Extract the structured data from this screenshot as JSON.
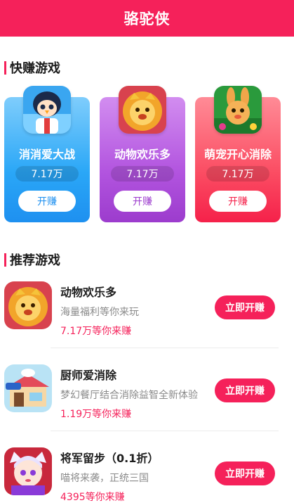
{
  "header": {
    "title": "骆驼侠"
  },
  "sections": {
    "quick": {
      "title": "快赚游戏"
    },
    "recommend": {
      "title": "推荐游戏"
    }
  },
  "featured": [
    {
      "name": "消消爱大战",
      "count": "7.17万",
      "button": "开赚",
      "icon": "penguin-character-icon",
      "color": "#2aa7f7"
    },
    {
      "name": "动物欢乐多",
      "count": "7.17万",
      "button": "开赚",
      "icon": "golden-lion-icon",
      "color": "#b254df"
    },
    {
      "name": "萌宠开心消除",
      "count": "7.17万",
      "button": "开赚",
      "icon": "rabbit-character-icon",
      "color": "#fb4d63"
    }
  ],
  "games": [
    {
      "name": "动物欢乐多",
      "desc": "海量福利等你来玩",
      "count": "7.17万等你来赚",
      "button": "立即开赚",
      "icon": "golden-lion-icon"
    },
    {
      "name": "厨师爱消除",
      "desc": "梦幻餐厅结合消除益智全新体验",
      "count": "1.19万等你来赚",
      "button": "立即开赚",
      "icon": "cafe-shop-icon"
    },
    {
      "name": "将军留步（0.1折）",
      "desc": "喵将来袭，正统三国",
      "count": "4395等你来赚",
      "button": "立即开赚",
      "icon": "general-character-icon"
    }
  ],
  "colors": {
    "accent": "#f5215a",
    "blue": "#2aa7f7",
    "purple": "#b254df",
    "red": "#fb4d63"
  }
}
